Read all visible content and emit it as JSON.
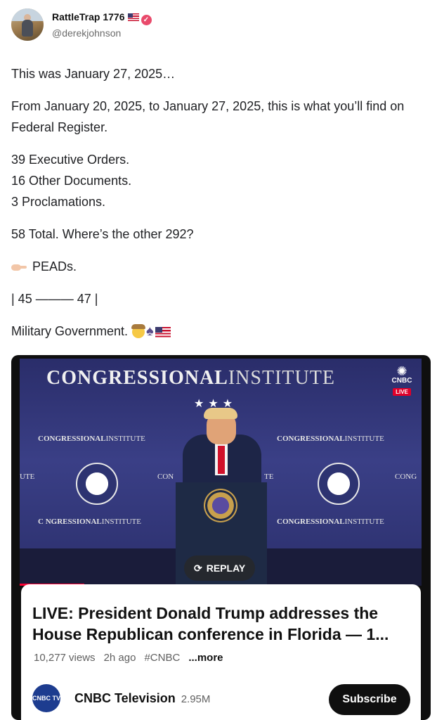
{
  "author": {
    "name": "RattleTrap 1776",
    "handle": "@derekjohnson",
    "flag_icon": "us-flag-icon",
    "verified_icon": "verified-badge-icon"
  },
  "post": {
    "line1": "This was January 27, 2025…",
    "line2": "From January 20, 2025, to January 27, 2025, this is what you’ll find on Federal Register.",
    "line3": "39 Executive Orders.",
    "line4": "16 Other Documents.",
    "line5": "3 Proclamations.",
    "line6": "58 Total. Where’s the other 292?",
    "line7": "PEADs.",
    "line8": "| 45 ——— 47 |",
    "line9": "Military Government."
  },
  "video": {
    "banner_bold": "CONGRESSIONAL",
    "banner_light": "INSTITUTE",
    "sub_bold": "CONGRESSIONAL",
    "sub_light": "INSTITUTE",
    "side_text_left": "UTE",
    "side_text_right": "CONG",
    "side_text_mid": "CON",
    "side_text_mid2": "TE",
    "side_text_bottom_left": "UT",
    "sub_bold_partial": "C NGRESSIONAL",
    "stars": "★★★",
    "network": "CNBC",
    "live_label": "LIVE",
    "replay_label": "REPLAY",
    "progress_fraction": 0.16,
    "title": "LIVE: President Donald Trump addresses the House Republican conference in Florida — 1...",
    "views": "10,277 views",
    "age": "2h ago",
    "hashtag": "#CNBC",
    "more_label": "...more",
    "channel_name": "CNBC Television",
    "subscribers": "2.95M",
    "subscribe_label": "Subscribe",
    "channel_logo_text": "CNBC TV"
  }
}
